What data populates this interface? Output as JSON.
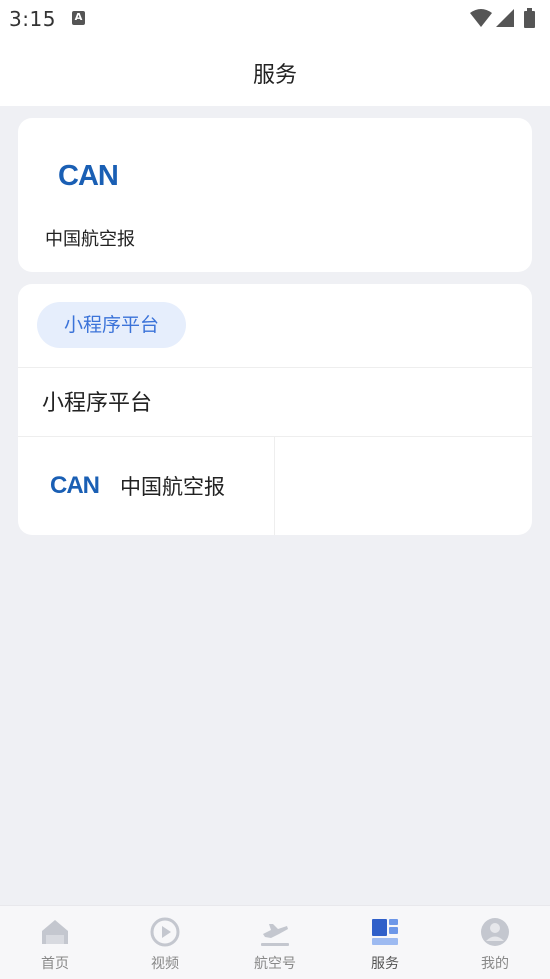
{
  "status_bar": {
    "time": "3:15",
    "app_icon_letter": "A",
    "icons": [
      "wifi-icon",
      "signal-icon",
      "battery-icon"
    ]
  },
  "header": {
    "title": "服务"
  },
  "card_1": {
    "logo_text": "CAN",
    "label": "中国航空报"
  },
  "card_2": {
    "tag_label": "小程序平台",
    "section_title": "小程序平台",
    "items": [
      {
        "logo_text": "CAN",
        "label": "中国航空报"
      }
    ]
  },
  "tab_bar": {
    "active_index": 3,
    "tabs": [
      {
        "label": "首页",
        "icon": "home-icon"
      },
      {
        "label": "视频",
        "icon": "video-play-icon"
      },
      {
        "label": "航空号",
        "icon": "airplane-icon"
      },
      {
        "label": "服务",
        "icon": "services-grid-icon"
      },
      {
        "label": "我的",
        "icon": "profile-icon"
      }
    ]
  },
  "colors": {
    "brand_blue": "#1a5fb4",
    "pill_bg": "#e6eefc",
    "pill_text": "#3b73d9",
    "page_bg": "#eff0f4",
    "tab_active": "#3b6fd6",
    "tab_inactive": "#c4c7cf"
  }
}
